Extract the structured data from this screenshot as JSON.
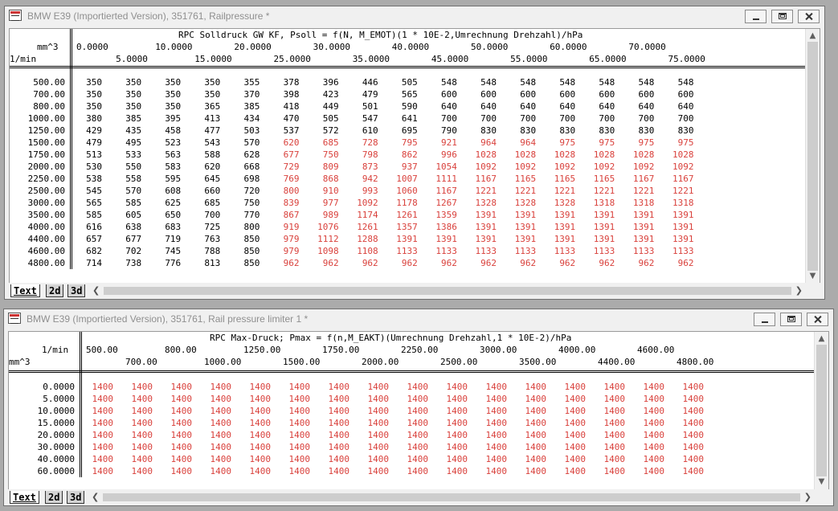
{
  "windows": [
    {
      "title": "BMW E39 (Importierted Version), 351761, Railpressure *",
      "map_title": "RPC Solldruck GW KF, Psoll = f(N, M_EMOT)(1 * 10E-2,Umrechnung Drehzahl)/hPa",
      "col_unit": "mm^3",
      "row_unit": "1/min",
      "col_headers": [
        "0.0000",
        "5.0000",
        "10.0000",
        "15.0000",
        "20.0000",
        "25.0000",
        "30.0000",
        "35.0000",
        "40.0000",
        "45.0000",
        "50.0000",
        "55.0000",
        "60.0000",
        "65.0000",
        "70.0000",
        "75.0000"
      ],
      "row_headers": [
        "500.00",
        "700.00",
        "800.00",
        "1000.00",
        "1250.00",
        "1500.00",
        "1750.00",
        "2000.00",
        "2250.00",
        "2500.00",
        "3000.00",
        "3500.00",
        "4000.00",
        "4400.00",
        "4600.00",
        "4800.00"
      ],
      "red_from_col": [
        99,
        99,
        99,
        99,
        99,
        5,
        5,
        5,
        5,
        5,
        5,
        5,
        5,
        5,
        5,
        5
      ],
      "values": [
        [
          350,
          350,
          350,
          350,
          355,
          378,
          396,
          446,
          505,
          548,
          548,
          548,
          548,
          548,
          548,
          548
        ],
        [
          350,
          350,
          350,
          350,
          370,
          398,
          423,
          479,
          565,
          600,
          600,
          600,
          600,
          600,
          600,
          600
        ],
        [
          350,
          350,
          350,
          365,
          385,
          418,
          449,
          501,
          590,
          640,
          640,
          640,
          640,
          640,
          640,
          640
        ],
        [
          380,
          385,
          395,
          413,
          434,
          470,
          505,
          547,
          641,
          700,
          700,
          700,
          700,
          700,
          700,
          700
        ],
        [
          429,
          435,
          458,
          477,
          503,
          537,
          572,
          610,
          695,
          790,
          830,
          830,
          830,
          830,
          830,
          830
        ],
        [
          479,
          495,
          523,
          543,
          570,
          620,
          685,
          728,
          795,
          921,
          964,
          964,
          975,
          975,
          975,
          975
        ],
        [
          513,
          533,
          563,
          588,
          628,
          677,
          750,
          798,
          862,
          996,
          1028,
          1028,
          1028,
          1028,
          1028,
          1028
        ],
        [
          530,
          550,
          583,
          620,
          668,
          729,
          809,
          873,
          937,
          1054,
          1092,
          1092,
          1092,
          1092,
          1092,
          1092
        ],
        [
          538,
          558,
          595,
          645,
          698,
          769,
          868,
          942,
          1007,
          1111,
          1167,
          1165,
          1165,
          1165,
          1167,
          1167
        ],
        [
          545,
          570,
          608,
          660,
          720,
          800,
          910,
          993,
          1060,
          1167,
          1221,
          1221,
          1221,
          1221,
          1221,
          1221
        ],
        [
          565,
          585,
          625,
          685,
          750,
          839,
          977,
          1092,
          1178,
          1267,
          1328,
          1328,
          1328,
          1318,
          1318,
          1318
        ],
        [
          585,
          605,
          650,
          700,
          770,
          867,
          989,
          1174,
          1261,
          1359,
          1391,
          1391,
          1391,
          1391,
          1391,
          1391
        ],
        [
          616,
          638,
          683,
          725,
          800,
          919,
          1076,
          1261,
          1357,
          1386,
          1391,
          1391,
          1391,
          1391,
          1391,
          1391
        ],
        [
          657,
          677,
          719,
          763,
          850,
          979,
          1112,
          1288,
          1391,
          1391,
          1391,
          1391,
          1391,
          1391,
          1391,
          1391
        ],
        [
          682,
          702,
          745,
          788,
          850,
          979,
          1098,
          1108,
          1133,
          1133,
          1133,
          1133,
          1133,
          1133,
          1133,
          1133
        ],
        [
          714,
          738,
          776,
          813,
          850,
          962,
          962,
          962,
          962,
          962,
          962,
          962,
          962,
          962,
          962,
          962
        ]
      ]
    },
    {
      "title": "BMW E39 (Importierted Version), 351761, Rail pressure limiter 1 *",
      "map_title": "RPC Max-Druck; Pmax = f(n,M_EAKT)(Umrechnung Drehzahl,1 * 10E-2)/hPa",
      "col_unit": "1/min",
      "row_unit": "mm^3",
      "col_headers": [
        "500.00",
        "700.00",
        "800.00",
        "1000.00",
        "1250.00",
        "1500.00",
        "1750.00",
        "2000.00",
        "2250.00",
        "2500.00",
        "3000.00",
        "3500.00",
        "4000.00",
        "4400.00",
        "4600.00",
        "4800.00"
      ],
      "row_headers": [
        "0.0000",
        "5.0000",
        "10.0000",
        "15.0000",
        "20.0000",
        "30.0000",
        "40.0000",
        "60.0000"
      ],
      "red_from_col": [
        0,
        0,
        0,
        0,
        0,
        0,
        0,
        0
      ],
      "values": [
        [
          1400,
          1400,
          1400,
          1400,
          1400,
          1400,
          1400,
          1400,
          1400,
          1400,
          1400,
          1400,
          1400,
          1400,
          1400,
          1400
        ],
        [
          1400,
          1400,
          1400,
          1400,
          1400,
          1400,
          1400,
          1400,
          1400,
          1400,
          1400,
          1400,
          1400,
          1400,
          1400,
          1400
        ],
        [
          1400,
          1400,
          1400,
          1400,
          1400,
          1400,
          1400,
          1400,
          1400,
          1400,
          1400,
          1400,
          1400,
          1400,
          1400,
          1400
        ],
        [
          1400,
          1400,
          1400,
          1400,
          1400,
          1400,
          1400,
          1400,
          1400,
          1400,
          1400,
          1400,
          1400,
          1400,
          1400,
          1400
        ],
        [
          1400,
          1400,
          1400,
          1400,
          1400,
          1400,
          1400,
          1400,
          1400,
          1400,
          1400,
          1400,
          1400,
          1400,
          1400,
          1400
        ],
        [
          1400,
          1400,
          1400,
          1400,
          1400,
          1400,
          1400,
          1400,
          1400,
          1400,
          1400,
          1400,
          1400,
          1400,
          1400,
          1400
        ],
        [
          1400,
          1400,
          1400,
          1400,
          1400,
          1400,
          1400,
          1400,
          1400,
          1400,
          1400,
          1400,
          1400,
          1400,
          1400,
          1400
        ],
        [
          1400,
          1400,
          1400,
          1400,
          1400,
          1400,
          1400,
          1400,
          1400,
          1400,
          1400,
          1400,
          1400,
          1400,
          1400,
          1400
        ]
      ]
    }
  ],
  "tabs": [
    "Text",
    "2d",
    "3d"
  ],
  "colors": {
    "highlight": "#d9413c",
    "window_bg": "#f0f0f0"
  }
}
